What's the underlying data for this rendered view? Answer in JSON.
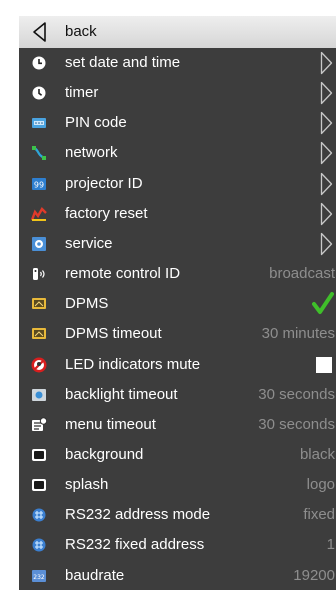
{
  "menu": {
    "back_label": "back",
    "items": [
      {
        "label": "set date and time",
        "icon": "clock-icon",
        "control": "submenu"
      },
      {
        "label": "timer",
        "icon": "timer-icon",
        "control": "submenu"
      },
      {
        "label": "PIN code",
        "icon": "pin-code-icon",
        "control": "submenu"
      },
      {
        "label": "network",
        "icon": "network-icon",
        "control": "submenu"
      },
      {
        "label": "projector ID",
        "icon": "projector-id-icon",
        "control": "submenu"
      },
      {
        "label": "factory reset",
        "icon": "factory-reset-icon",
        "control": "submenu"
      },
      {
        "label": "service",
        "icon": "service-icon",
        "control": "submenu"
      },
      {
        "label": "remote control ID",
        "icon": "remote-control-icon",
        "control": "value",
        "value": "broadcast"
      },
      {
        "label": "DPMS",
        "icon": "dpms-icon",
        "control": "check",
        "checked": true
      },
      {
        "label": "DPMS timeout",
        "icon": "dpms-timeout-icon",
        "control": "value",
        "value": "30 minutes"
      },
      {
        "label": "LED indicators mute",
        "icon": "led-mute-icon",
        "control": "toggle",
        "checked": false
      },
      {
        "label": "backlight timeout",
        "icon": "backlight-icon",
        "control": "value",
        "value": "30 seconds"
      },
      {
        "label": "menu timeout",
        "icon": "menu-timeout-icon",
        "control": "value",
        "value": "30 seconds"
      },
      {
        "label": "background",
        "icon": "background-icon",
        "control": "value",
        "value": "black"
      },
      {
        "label": "splash",
        "icon": "splash-icon",
        "control": "value",
        "value": "logo"
      },
      {
        "label": "RS232 address mode",
        "icon": "rs232-mode-icon",
        "control": "value",
        "value": "fixed"
      },
      {
        "label": "RS232 fixed address",
        "icon": "rs232-address-icon",
        "control": "value",
        "value": "1"
      },
      {
        "label": "baudrate",
        "icon": "baudrate-icon",
        "control": "value",
        "value": "19200"
      }
    ]
  },
  "colors": {
    "panel_background": "#3d3d3d",
    "label_text": "#ffffff",
    "value_text": "#8e8e8e",
    "check_green": "#3fbf2a",
    "led_red": "#d81e1e"
  }
}
